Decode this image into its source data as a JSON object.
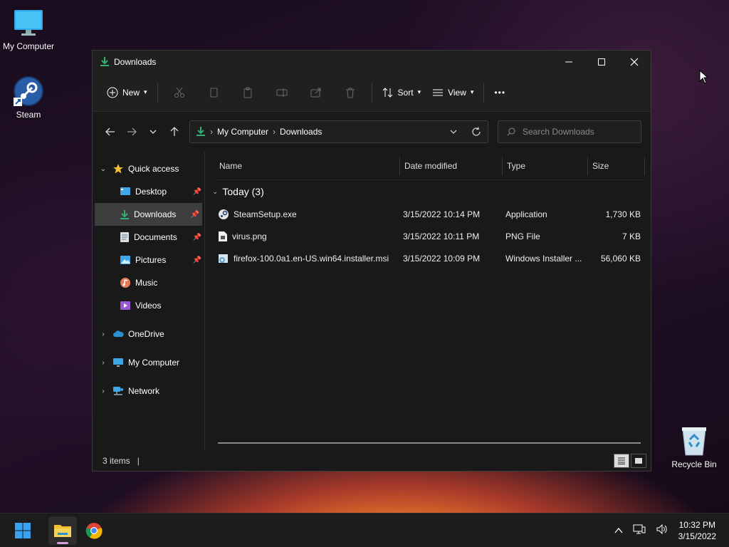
{
  "desktop": {
    "icons": [
      {
        "label": "My Computer"
      },
      {
        "label": "Steam"
      },
      {
        "label": "Recycle Bin"
      }
    ]
  },
  "window": {
    "title": "Downloads",
    "toolbar": {
      "new_label": "New",
      "sort_label": "Sort",
      "view_label": "View",
      "more_label": "•••"
    },
    "address": {
      "crumbs": [
        "My Computer",
        "Downloads"
      ]
    },
    "search": {
      "placeholder": "Search Downloads"
    },
    "sidebar": {
      "quick_access": "Quick access",
      "items": [
        {
          "label": "Desktop",
          "pinned": true
        },
        {
          "label": "Downloads",
          "pinned": true,
          "selected": true
        },
        {
          "label": "Documents",
          "pinned": true
        },
        {
          "label": "Pictures",
          "pinned": true
        },
        {
          "label": "Music",
          "pinned": false
        },
        {
          "label": "Videos",
          "pinned": false
        }
      ],
      "onedrive": "OneDrive",
      "my_computer": "My Computer",
      "network": "Network"
    },
    "columns": [
      "Name",
      "Date modified",
      "Type",
      "Size"
    ],
    "group": {
      "label": "Today (3)"
    },
    "files": [
      {
        "name": "SteamSetup.exe",
        "date": "3/15/2022 10:14 PM",
        "type": "Application",
        "size": "1,730 KB"
      },
      {
        "name": "virus.png",
        "date": "3/15/2022 10:11 PM",
        "type": "PNG File",
        "size": "7 KB"
      },
      {
        "name": "firefox-100.0a1.en-US.win64.installer.msi",
        "date": "3/15/2022 10:09 PM",
        "type": "Windows Installer ...",
        "size": "56,060 KB"
      }
    ],
    "status": {
      "count": "3 items",
      "cursor": "|"
    }
  },
  "taskbar": {
    "time": "10:32 PM",
    "date": "3/15/2022"
  },
  "colors": {
    "accent_green": "#2fb16f",
    "folder_yellow": "#f2c12e",
    "start_blue": "#3aa0f0"
  }
}
